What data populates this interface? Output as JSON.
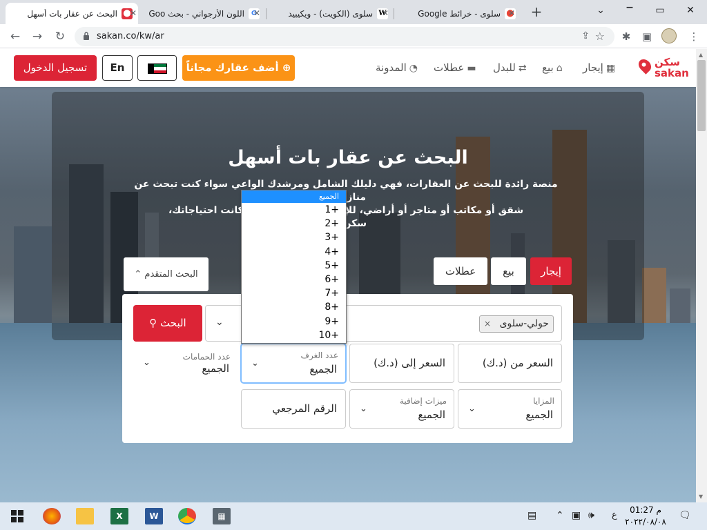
{
  "browser": {
    "tabs": [
      {
        "title": "البحث عن عقار بات أسهل",
        "active": true
      },
      {
        "title": "اللون الأرجواني - بحث Goo"
      },
      {
        "title": "سلوى (الكويت) - ويكيبيد"
      },
      {
        "title": "سلوى - خرائط Google"
      }
    ],
    "url": "sakan.co/kw/ar",
    "new_tab": "+",
    "win_min": "⌄",
    "win_restore": "▭",
    "win_close": "✕"
  },
  "header": {
    "logo_ar": "سكن",
    "logo_en": "sakan",
    "nav": [
      {
        "label": "إيجار",
        "icon": "building-icon"
      },
      {
        "label": "بيع",
        "icon": "home-icon"
      },
      {
        "label": "للبدل",
        "icon": "exchange-icon"
      },
      {
        "label": "عطلات",
        "icon": "bed-icon"
      },
      {
        "label": "المدونة",
        "icon": "rss-icon"
      }
    ],
    "add_property": "أضف عقارك مجاناً",
    "lang": "En",
    "login": "تسجيل الدخول"
  },
  "hero": {
    "title": "البحث عن عقار بات أسهل",
    "desc_line1": "منصة رائدة للبحث عن العقارات، فهي دليلك الشامل ومرشدك الواعي سواء كنت تبحث عن منازل أو",
    "desc_line2": "شقق أو مكاتب أو متاجر أو أراضي، للإيجار أو للبيع ... مهما كانت احتياجاتك،",
    "desc_line3": "سكن هنا"
  },
  "search": {
    "tabs": [
      "إيجار",
      "بيع",
      "عطلات"
    ],
    "advanced": "البحث المتقدم",
    "search_button": "البحث",
    "location_tag": "حولي-سلوى",
    "location_tag_remove": "×",
    "price_from": "السعر من (د.ك)",
    "price_to": "السعر إلى (د.ك)",
    "rooms_label": "عدد الغرف",
    "rooms_value": "الجميع",
    "baths_label": "عدد الحمامات",
    "baths_value": "الجميع",
    "features_label": "المزايا",
    "features_value": "الجميع",
    "extra_label": "ميزات إضافية",
    "extra_value": "الجميع",
    "ref_placeholder": "الرقم المرجعي"
  },
  "rooms_dropdown": {
    "selected": "الجميع",
    "options": [
      "1+",
      "2+",
      "3+",
      "4+",
      "5+",
      "6+",
      "7+",
      "8+",
      "9+",
      "10+"
    ]
  },
  "taskbar": {
    "apps": [
      "start",
      "firefox",
      "file-explorer",
      "excel",
      "word",
      "chrome",
      "calculator"
    ],
    "lang": "ع",
    "time": "01:27 م",
    "date": "٢٠٢٢/٠٨/٠٨"
  },
  "colors": {
    "brand_red": "#dc2436",
    "orange": "#fb9316"
  }
}
